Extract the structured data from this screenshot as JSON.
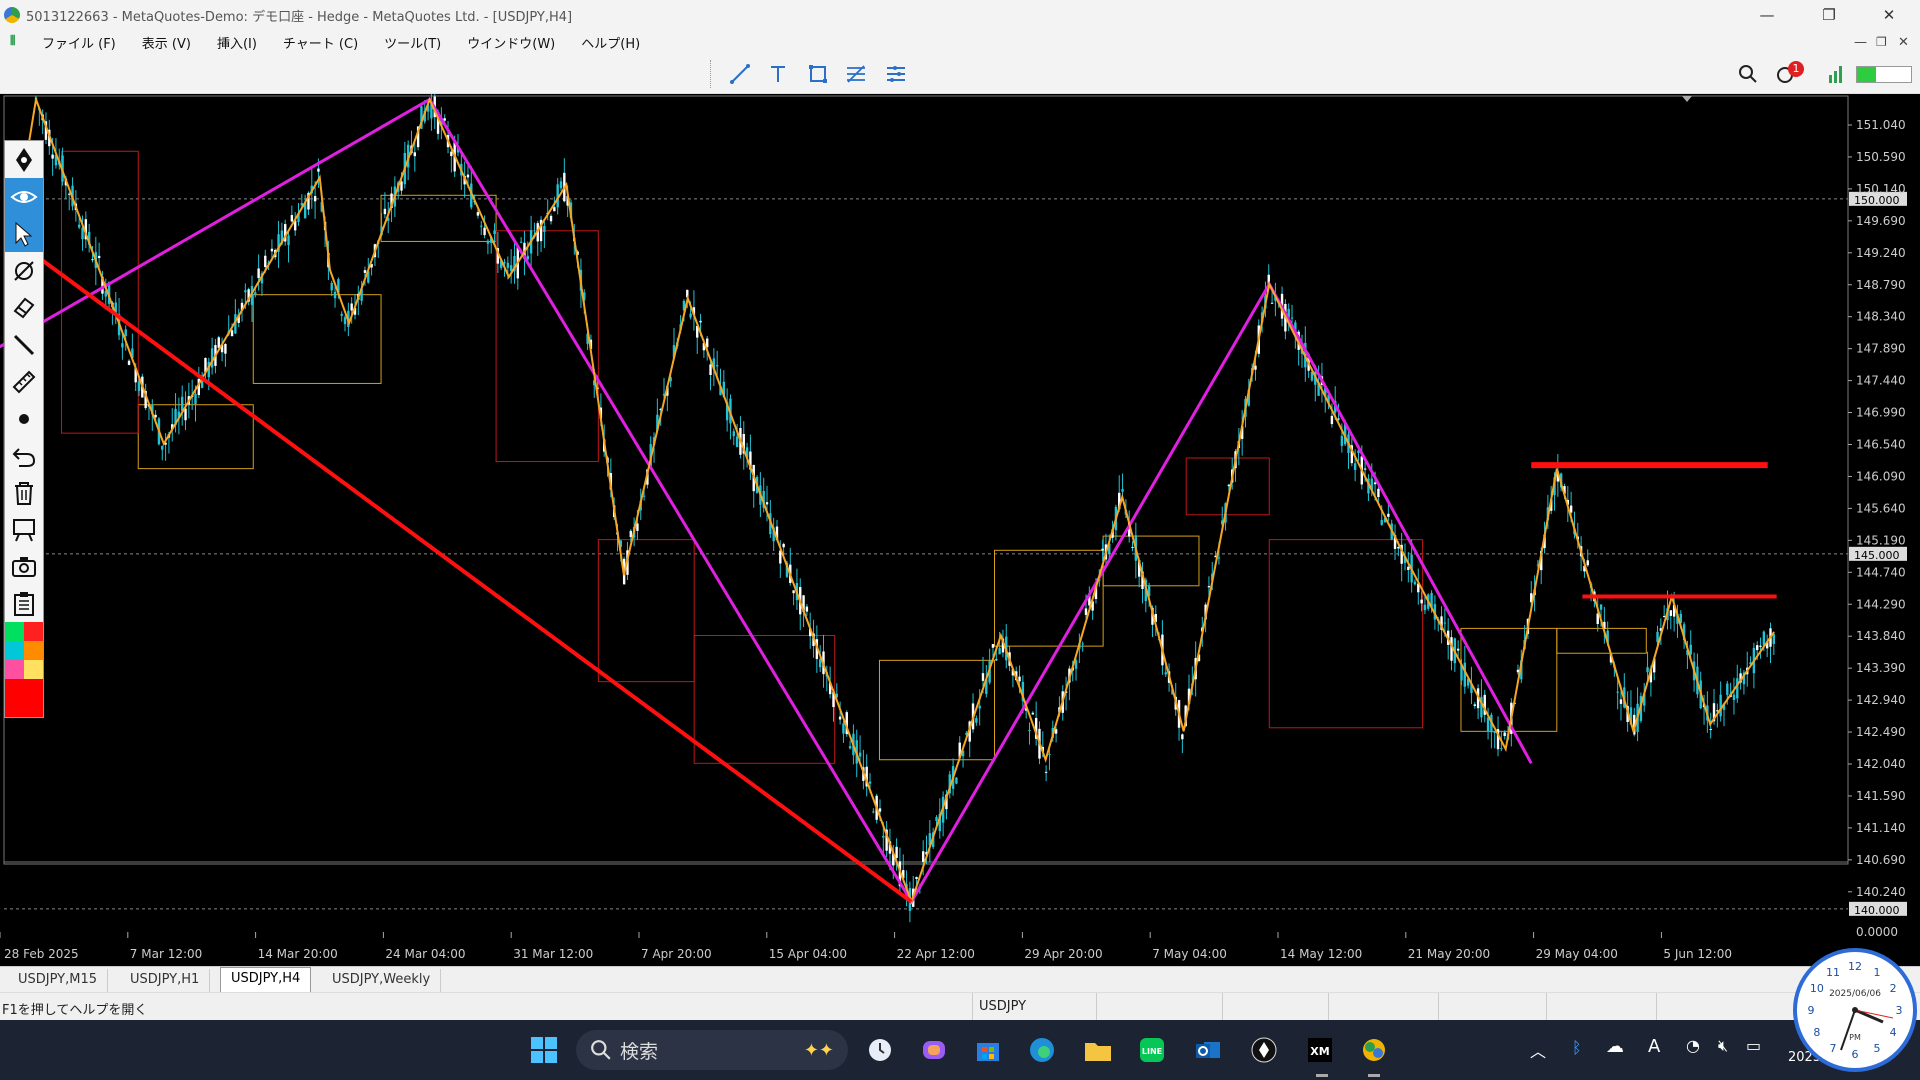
{
  "window": {
    "title": "5013122663 - MetaQuotes-Demo: デモ口座 - Hedge - MetaQuotes Ltd. - [USDJPY,H4]",
    "minimize": "—",
    "restore": "❐",
    "close": "✕"
  },
  "menu": {
    "items": [
      "ファイル (F)",
      "表示 (V)",
      "挿入(I)",
      "チャート (C)",
      "ツール(T)",
      "ウインドウ(W)",
      "ヘルプ(H)"
    ]
  },
  "toolbar": {
    "notification_count": "1"
  },
  "chart": {
    "symbol": "USDJPY",
    "timeframe": "H4",
    "price_ticks": [
      "151.040",
      "150.590",
      "150.140",
      "149.690",
      "149.240",
      "148.790",
      "148.340",
      "147.890",
      "147.440",
      "146.990",
      "146.540",
      "146.090",
      "145.640",
      "145.190",
      "144.740",
      "144.290",
      "143.840",
      "143.390",
      "142.940",
      "142.490",
      "142.040",
      "141.590",
      "141.140",
      "140.690",
      "140.240"
    ],
    "price_highlight_labels": [
      "150.000",
      "145.000",
      "140.000"
    ],
    "indicator_zero": "0.0000",
    "time_ticks": [
      "28 Feb 2025",
      "7 Mar 12:00",
      "14 Mar 20:00",
      "24 Mar 04:00",
      "31 Mar 12:00",
      "7 Apr 20:00",
      "15 Apr 04:00",
      "22 Apr 12:00",
      "29 Apr 20:00",
      "7 May 04:00",
      "14 May 12:00",
      "21 May 20:00",
      "29 May 04:00",
      "5 Jun 12:00"
    ],
    "colors": {
      "candle": "#21c3d6",
      "zigzag_fast": "#f5a623",
      "zigzag_slow": "#e020e0",
      "trendline": "#ff1010",
      "box_gold": "#d4a017",
      "box_red": "#c01818"
    }
  },
  "tabs": [
    "USDJPY,M15",
    "USDJPY,H1",
    "USDJPY,H4",
    "USDJPY,Weekly"
  ],
  "active_tab": "USDJPY,H4",
  "status": {
    "help": "F1を押してヘルプを開く",
    "symbol": "USDJPY"
  },
  "taskbar": {
    "search_label": "検索",
    "clock_date": "2025/06/06",
    "clock_ampm": "PM",
    "clock_year_partial": "2025"
  }
}
